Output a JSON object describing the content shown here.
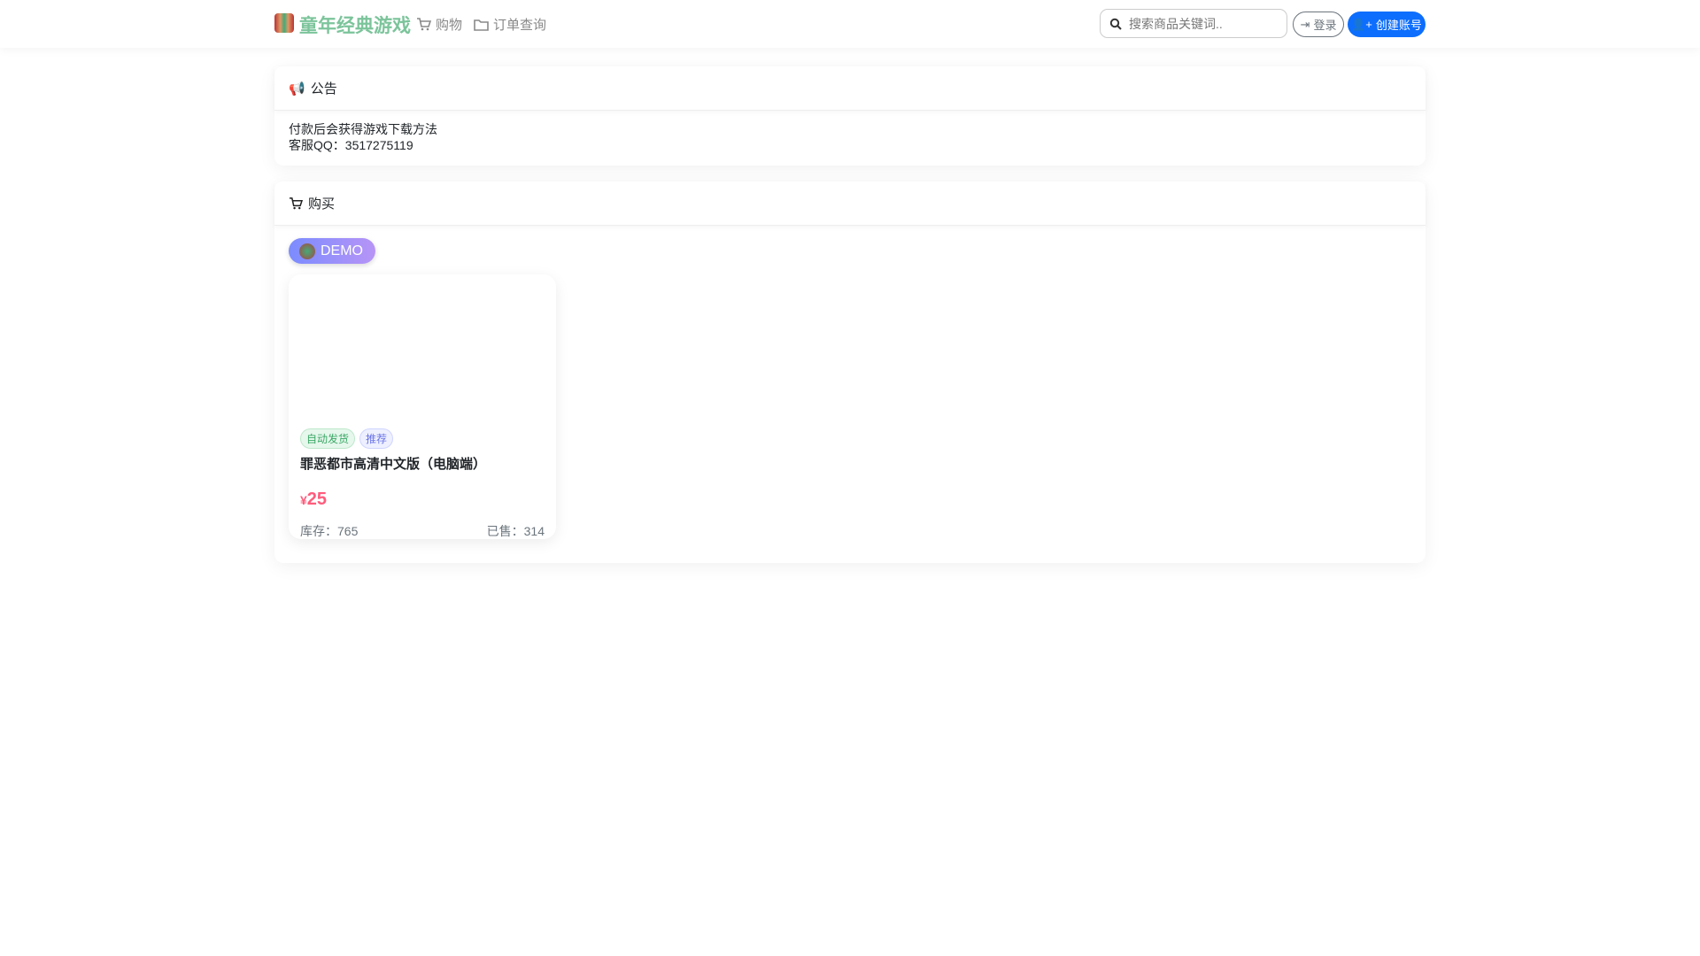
{
  "nav": {
    "brand": "童年经典游戏",
    "links": [
      "购物",
      "订单查询"
    ],
    "search_placeholder": "搜索商品关键词..",
    "login": "登录",
    "create_account": "创建账号"
  },
  "notice": {
    "title": "公告",
    "lines": [
      "付款后会获得游戏下载方法",
      "客服QQ：3517275119"
    ]
  },
  "shop": {
    "title": "购买",
    "category": "DEMO",
    "products": [
      {
        "tags": [
          "自动发货",
          "推荐"
        ],
        "name": "罪恶都市高清中文版（电脑端）",
        "currency": "¥",
        "price": "25",
        "stock": "库存：765",
        "sold": "已售：314"
      }
    ]
  },
  "colors": {
    "brand": "#7cc49b",
    "primary": "#0d6efd",
    "price": "#ff5c7c"
  }
}
